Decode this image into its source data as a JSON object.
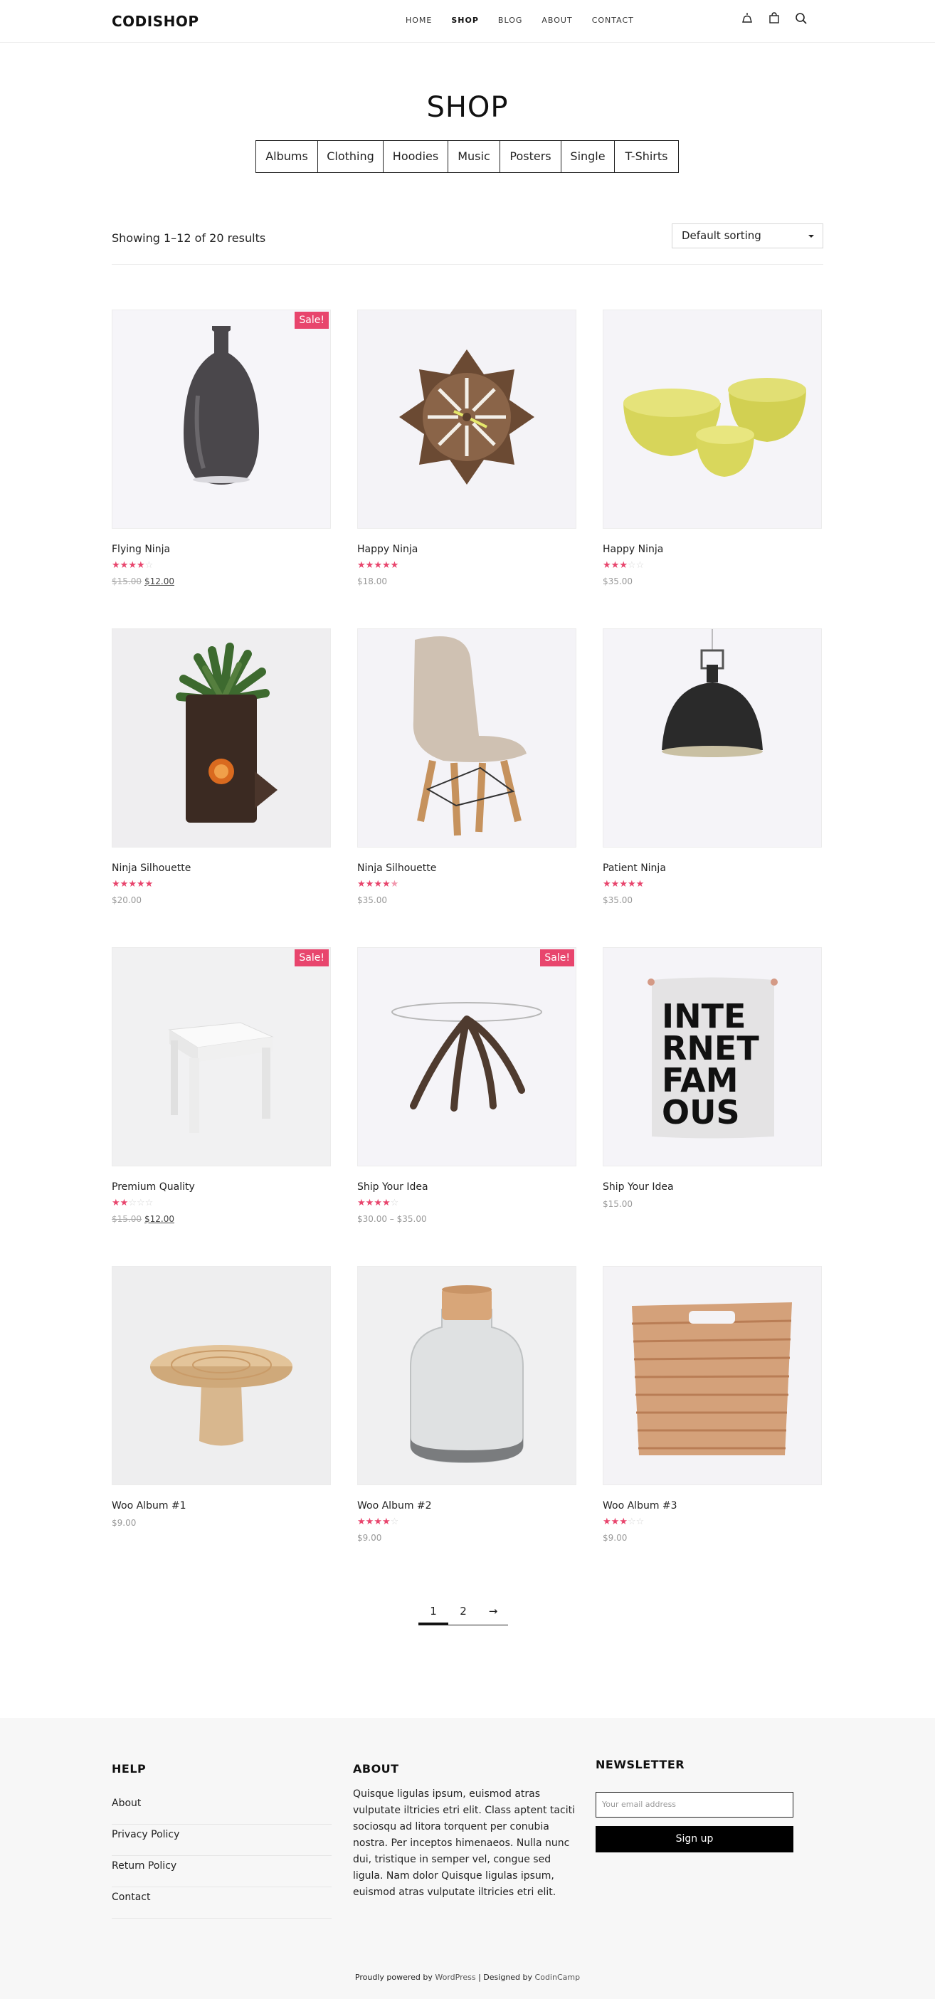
{
  "header": {
    "logo": "CODISHOP",
    "nav": [
      "HOME",
      "SHOP",
      "BLOG",
      "ABOUT",
      "CONTACT"
    ],
    "active_nav": "SHOP",
    "icons": [
      "user-icon",
      "cart-icon",
      "search-icon"
    ]
  },
  "page_title": "SHOP",
  "categories": [
    "Albums",
    "Clothing",
    "Hoodies",
    "Music",
    "Posters",
    "Single",
    "T-Shirts"
  ],
  "toolbar": {
    "result_count": "Showing 1–12 of 20 results",
    "sort_value": "Default sorting"
  },
  "products": [
    {
      "name": "Flying Ninja",
      "rating": 4,
      "price_old": "$15.00",
      "price": "$12.00",
      "sale": true,
      "image": "vase-bottle"
    },
    {
      "name": "Happy Ninja",
      "rating": 5,
      "price": "$18.00",
      "sale": false,
      "image": "wooden-clock"
    },
    {
      "name": "Happy Ninja",
      "rating": 3,
      "price": "$35.00",
      "sale": false,
      "image": "yellow-bowls"
    },
    {
      "name": "Ninja Silhouette",
      "rating": 5,
      "price": "$20.00",
      "sale": false,
      "image": "plant-pot"
    },
    {
      "name": "Ninja Silhouette",
      "rating": 4.5,
      "price": "$35.00",
      "sale": false,
      "image": "chair"
    },
    {
      "name": "Patient Ninja",
      "rating": 5,
      "price": "$35.00",
      "sale": false,
      "image": "pendant-lamp"
    },
    {
      "name": "Premium Quality",
      "rating": 2,
      "price_old": "$15.00",
      "price": "$12.00",
      "sale": true,
      "image": "white-stool"
    },
    {
      "name": "Ship Your Idea",
      "rating": 4,
      "price": "$30.00 – $35.00",
      "sale": true,
      "image": "glass-table"
    },
    {
      "name": "Ship Your Idea",
      "rating": 0,
      "price": "$15.00",
      "sale": false,
      "image": "internet-famous-poster"
    },
    {
      "name": "Woo Album #1",
      "rating": 0,
      "price": "$9.00",
      "sale": false,
      "image": "wooden-stand"
    },
    {
      "name": "Woo Album #2",
      "rating": 4,
      "price": "$9.00",
      "sale": false,
      "image": "glass-jar"
    },
    {
      "name": "Woo Album #3",
      "rating": 3,
      "price": "$9.00",
      "sale": false,
      "image": "wicker-basket"
    }
  ],
  "sale_label": "Sale!",
  "poster_text": [
    "INTE",
    "RNET",
    "FAM",
    "OUS"
  ],
  "pagination": [
    "1",
    "2",
    "→"
  ],
  "footer": {
    "help_title": "HELP",
    "help_links": [
      "About",
      "Privacy Policy",
      "Return Policy",
      "Contact"
    ],
    "about_title": "ABOUT",
    "about_text": "Quisque ligulas ipsum, euismod atras vulputate iltricies etri elit. Class aptent taciti sociosqu ad litora torquent per conubia nostra. Per inceptos himenaeos. Nulla nunc dui, tristique in semper vel, congue sed ligula. Nam dolor Quisque ligulas ipsum, euismod atras vulputate iltricies etri elit.",
    "newsletter_title": "NEWSLETTER",
    "email_placeholder": "Your email address",
    "signup_label": "Sign up",
    "copyright_prefix": "Proudly powered by ",
    "copyright_wp": "WordPress",
    "copyright_mid": " | Designed by ",
    "copyright_by": "CodinCamp"
  },
  "colors": {
    "accent": "#e8456d",
    "dark": "#111111",
    "footer_bg": "#f7f7f7"
  }
}
